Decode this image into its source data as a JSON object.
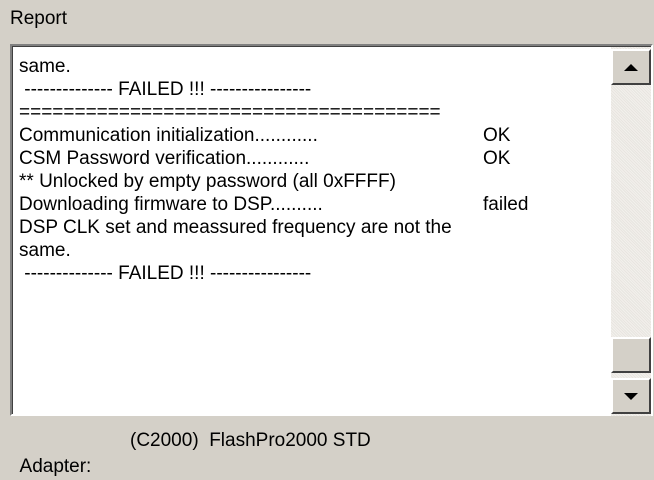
{
  "report": {
    "title": "Report",
    "lines": [
      {
        "text": "same.",
        "status": ""
      },
      {
        "text": " -------------- FAILED !!! ----------------",
        "status": ""
      },
      {
        "text": "======================================",
        "status": ""
      },
      {
        "text": "Communication initialization............",
        "status": "OK"
      },
      {
        "text": "CSM Password verification............",
        "status": "OK"
      },
      {
        "text": "** Unlocked by empty password (all 0xFFFF)",
        "status": ""
      },
      {
        "text": "Downloading firmware to DSP..........",
        "status": "failed"
      },
      {
        "text": "DSP CLK set and meassured frequency are not the",
        "status": ""
      },
      {
        "text": "same.",
        "status": ""
      },
      {
        "text": " -------------- FAILED !!! ----------------",
        "status": ""
      }
    ]
  },
  "scrollbar": {
    "up_icon": "arrow-up-icon",
    "down_icon": "arrow-down-icon",
    "position": 0.92
  },
  "status_bar": {
    "label": "Adapter:",
    "value": "(C2000)  FlashPro2000 STD"
  }
}
